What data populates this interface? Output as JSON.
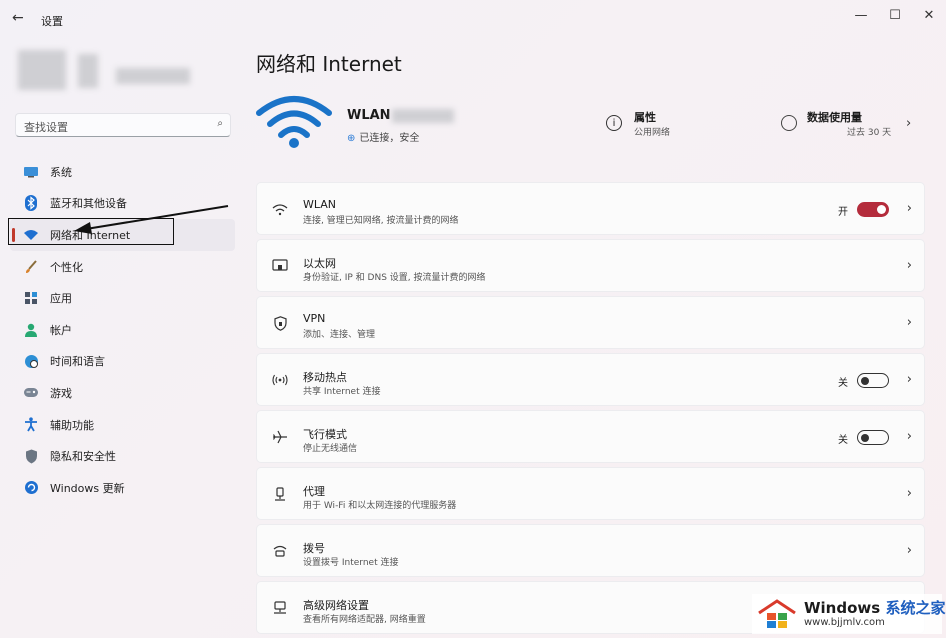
{
  "window": {
    "app_title": "设置",
    "controls": {
      "minimize": "—",
      "maximize": "☐",
      "close": "✕"
    }
  },
  "search": {
    "placeholder": "查找设置"
  },
  "sidebar": {
    "items": [
      {
        "label": "系统",
        "icon": "monitor-icon"
      },
      {
        "label": "蓝牙和其他设备",
        "icon": "bluetooth-icon"
      },
      {
        "label": "网络和 Internet",
        "icon": "wifi-icon",
        "active": true
      },
      {
        "label": "个性化",
        "icon": "brush-icon"
      },
      {
        "label": "应用",
        "icon": "apps-icon"
      },
      {
        "label": "帐户",
        "icon": "person-icon"
      },
      {
        "label": "时间和语言",
        "icon": "globe-clock-icon"
      },
      {
        "label": "游戏",
        "icon": "gamepad-icon"
      },
      {
        "label": "辅助功能",
        "icon": "accessibility-icon"
      },
      {
        "label": "隐私和安全性",
        "icon": "shield-icon"
      },
      {
        "label": "Windows 更新",
        "icon": "windows-update-icon"
      }
    ]
  },
  "main": {
    "title": "网络和 Internet",
    "hero": {
      "network_name": "WLAN",
      "status": "已连接，安全",
      "properties": {
        "title": "属性",
        "subtitle": "公用网络"
      },
      "data_usage": {
        "title": "数据使用量",
        "subtitle": "过去 30 天"
      }
    },
    "cards": [
      {
        "title": "WLAN",
        "subtitle": "连接, 管理已知网络, 按流量计费的网络",
        "icon": "wifi-icon",
        "toggle": "on",
        "toggle_label": "开"
      },
      {
        "title": "以太网",
        "subtitle": "身份验证, IP 和 DNS 设置, 按流量计费的网络",
        "icon": "ethernet-icon"
      },
      {
        "title": "VPN",
        "subtitle": "添加、连接、管理",
        "icon": "vpn-shield-icon"
      },
      {
        "title": "移动热点",
        "subtitle": "共享 Internet 连接",
        "icon": "hotspot-icon",
        "toggle": "off",
        "toggle_label": "关"
      },
      {
        "title": "飞行模式",
        "subtitle": "停止无线通信",
        "icon": "airplane-icon",
        "toggle": "off",
        "toggle_label": "关"
      },
      {
        "title": "代理",
        "subtitle": "用于 Wi-Fi 和以太网连接的代理服务器",
        "icon": "proxy-icon"
      },
      {
        "title": "拨号",
        "subtitle": "设置拨号 Internet 连接",
        "icon": "dialup-icon"
      },
      {
        "title": "高级网络设置",
        "subtitle": "查看所有网络适配器, 网络重置",
        "icon": "network-adapter-icon"
      }
    ]
  },
  "watermark": {
    "brand": "Windows",
    "brand_cn": "系统之家",
    "url": "www.bjjmlv.com"
  },
  "colors": {
    "accent": "#b42c3c",
    "active_indicator": "#c0392b",
    "wifi_blue": "#1a73c8"
  }
}
